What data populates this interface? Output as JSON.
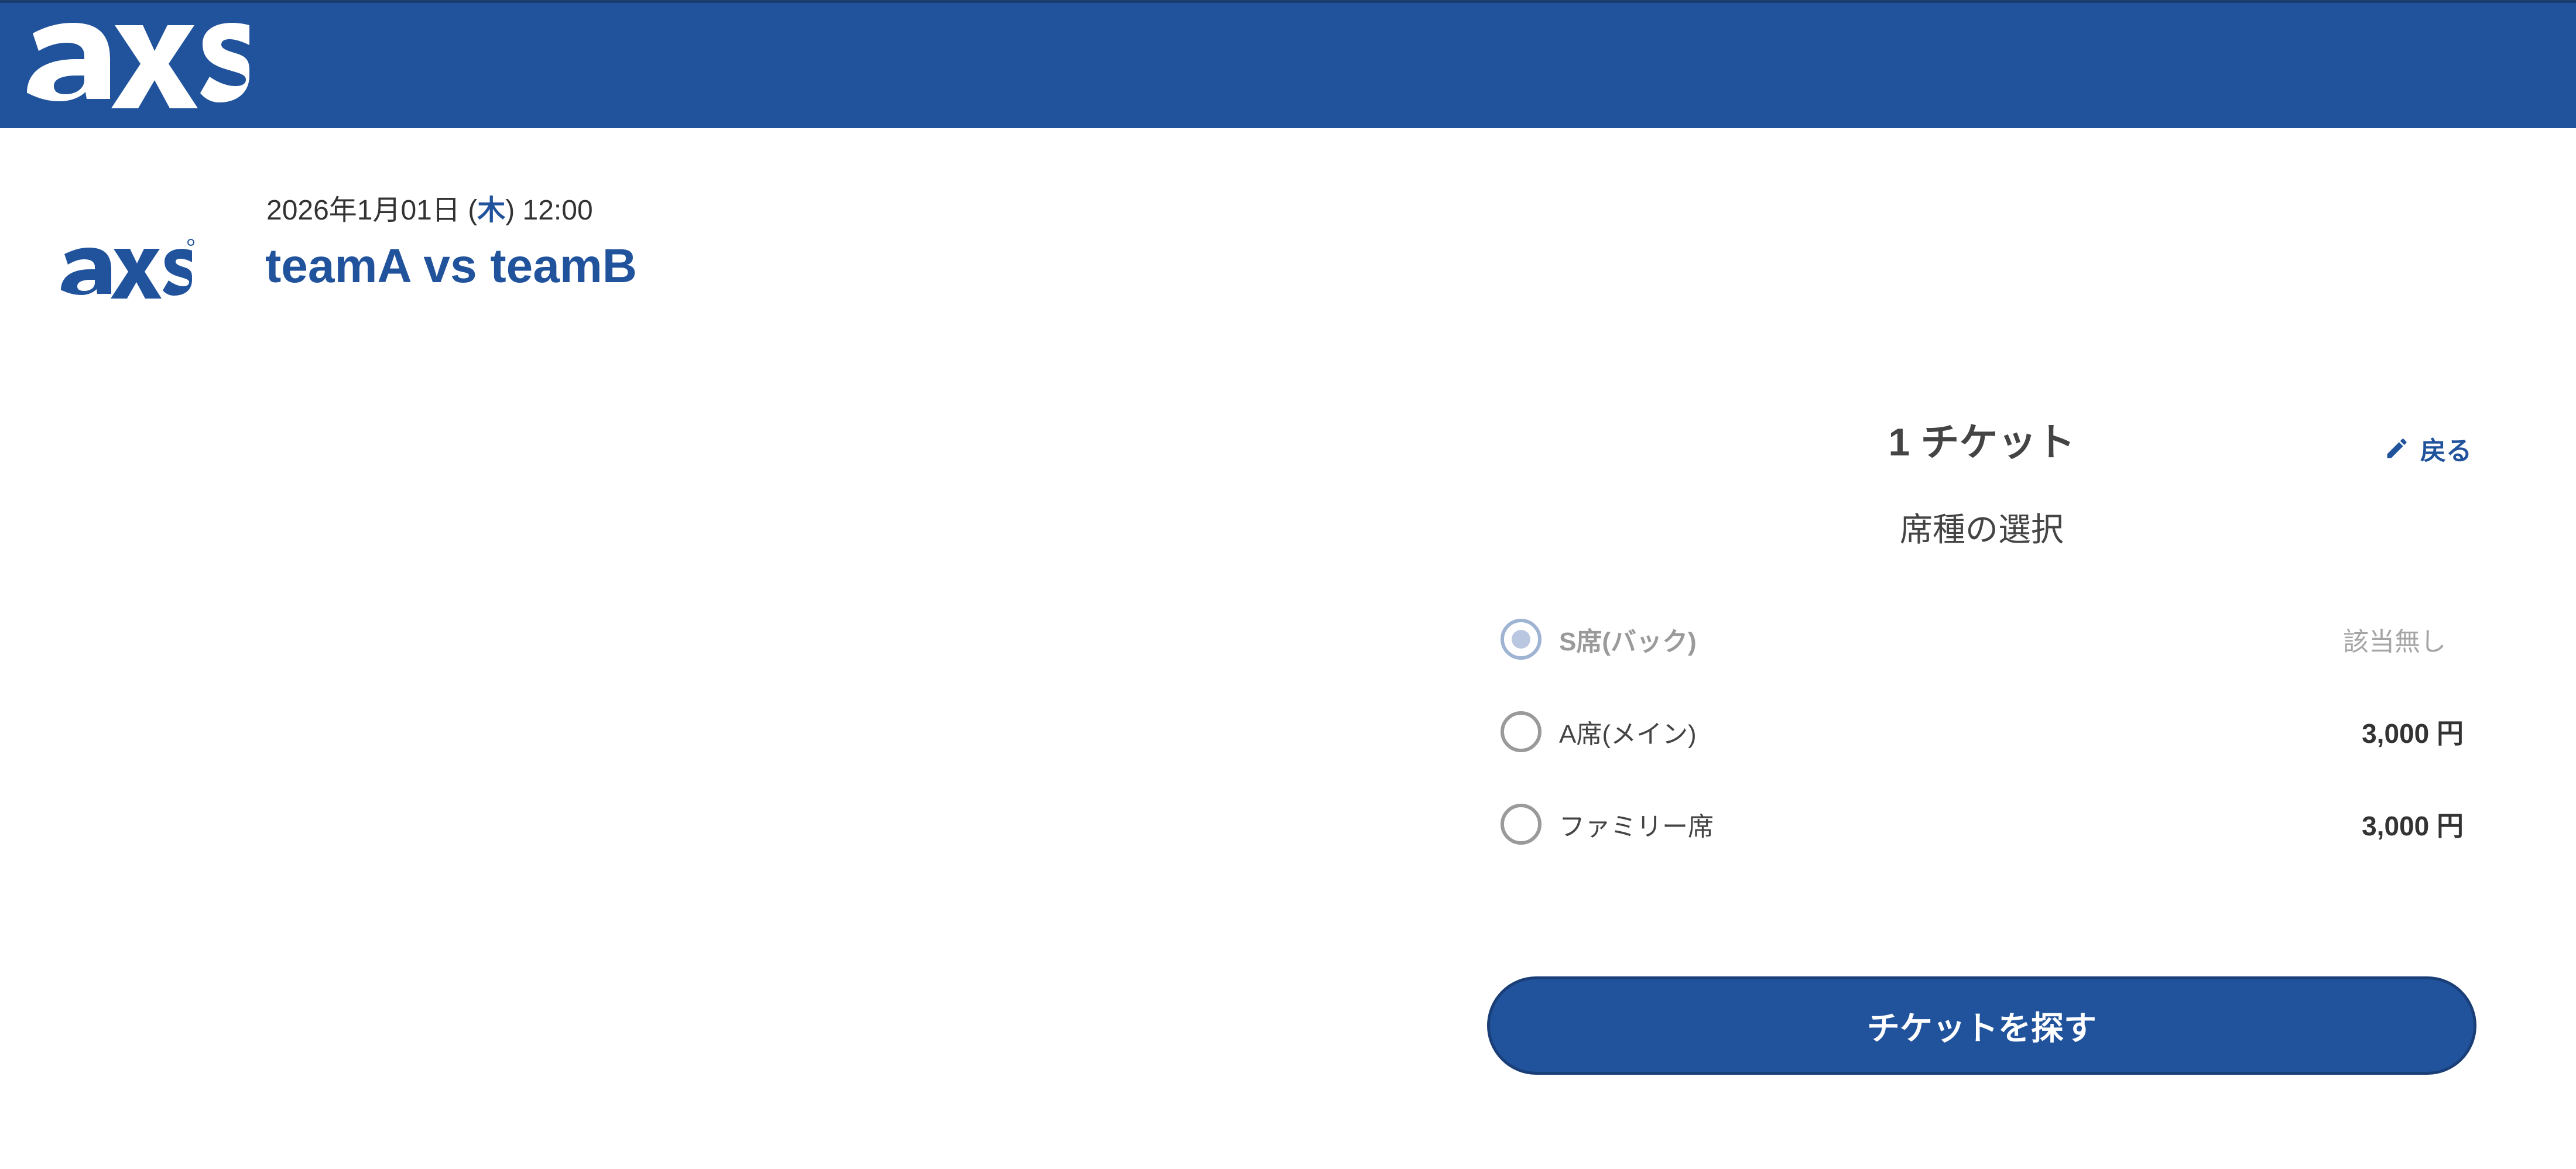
{
  "header": {
    "logo_icon": "axs-logo",
    "background_color": "#21539c"
  },
  "event": {
    "logo_icon": "axs-logo",
    "date_prefix": "2026年1月01日 (",
    "weekday": "木",
    "date_suffix": ") 12:00",
    "title": "teamA vs teamB"
  },
  "panel": {
    "ticket_count": "1 チケット",
    "back_label": "戻る",
    "back_icon": "pencil-icon",
    "section_title": "席種の選択",
    "seats": [
      {
        "label": "S席(バック)",
        "price": "該当無し",
        "available": false
      },
      {
        "label": "A席(メイン)",
        "price": "3,000 円",
        "available": true
      },
      {
        "label": "ファミリー席",
        "price": "3,000 円",
        "available": true
      }
    ],
    "search_button_label": "チケットを探す"
  },
  "colors": {
    "brand": "#21539c",
    "text": "#333333",
    "muted": "#9a9a9a"
  }
}
